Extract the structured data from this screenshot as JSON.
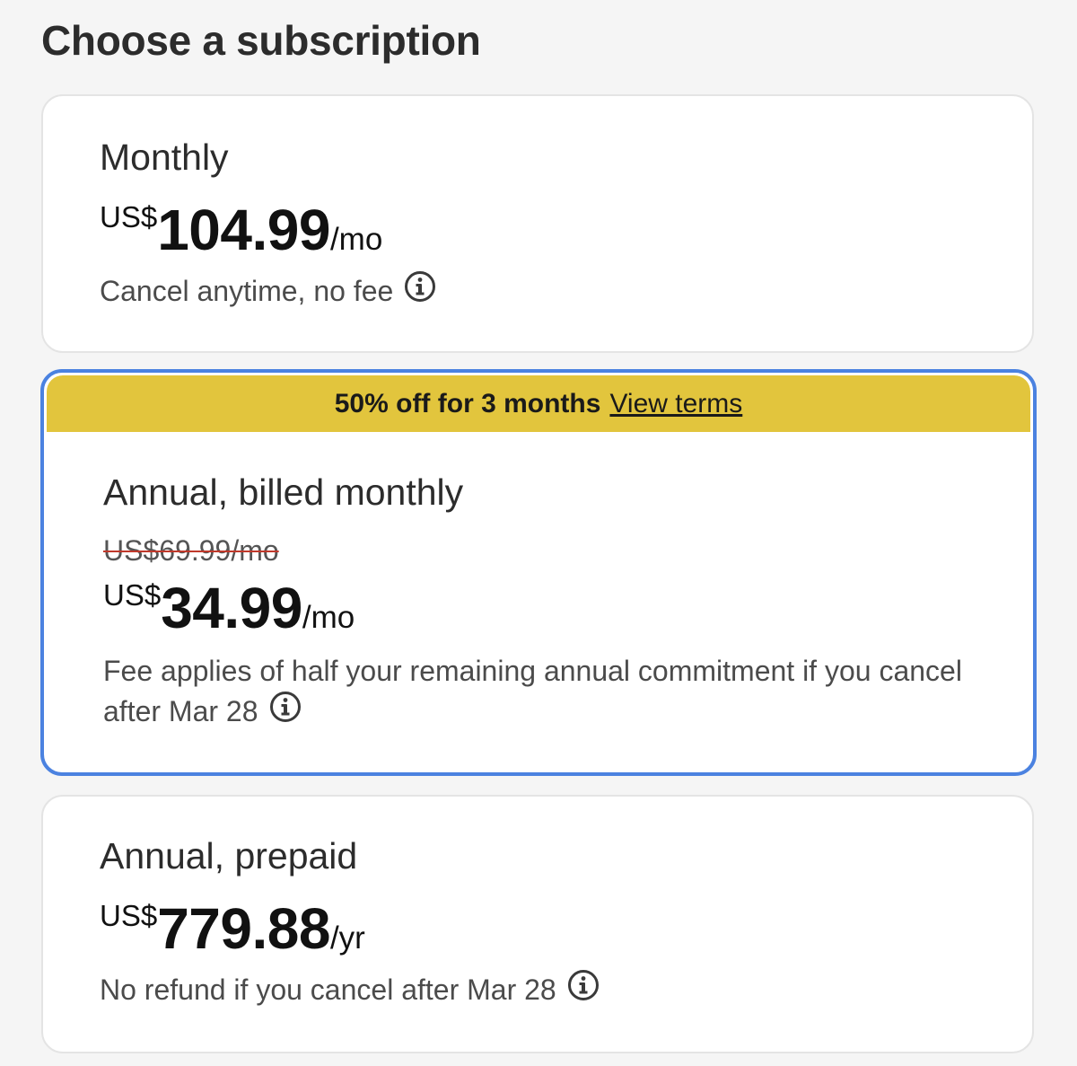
{
  "page": {
    "title": "Choose a subscription"
  },
  "plans": [
    {
      "name": "Monthly",
      "currency": "US$",
      "amount": "104.99",
      "period": "/mo",
      "note": "Cancel anytime, no fee",
      "selected": false
    },
    {
      "name": "Annual, billed monthly",
      "promo_text": "50% off for 3 months",
      "promo_link": "View terms",
      "original_price": "US$69.99/mo",
      "currency": "US$",
      "amount": "34.99",
      "period": "/mo",
      "note": "Fee applies of half your remaining annual commitment if you cancel after Mar 28",
      "selected": true
    },
    {
      "name": "Annual, prepaid",
      "currency": "US$",
      "amount": "779.88",
      "period": "/yr",
      "note": "No refund if you cancel after Mar 28",
      "selected": false
    }
  ],
  "icons": {
    "info": "info-icon"
  },
  "colors": {
    "selected_border": "#4b82e0",
    "promo_banner": "#e2c53d",
    "strikethrough": "#c0392b",
    "background": "#f5f5f5"
  }
}
